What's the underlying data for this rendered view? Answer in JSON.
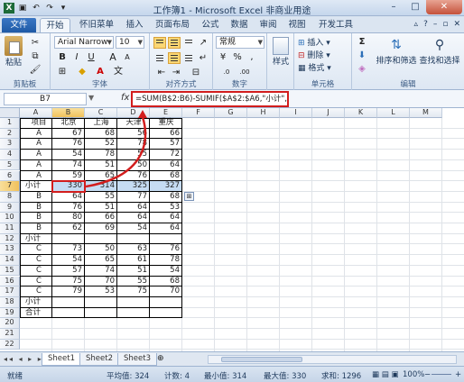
{
  "window": {
    "title": "工作簿1 - Microsoft Excel 非商业用途",
    "minimize": "–",
    "maximize": "□",
    "close": "✕"
  },
  "tabs": [
    "文件",
    "开始",
    "怀旧菜单",
    "插入",
    "页面布局",
    "公式",
    "数据",
    "审阅",
    "视图",
    "开发工具"
  ],
  "ribbon": {
    "clipboard": {
      "paste": "粘贴",
      "label": "剪贴板"
    },
    "font": {
      "name": "Arial Narrow",
      "size": "10",
      "bold": "B",
      "italic": "I",
      "underline": "U",
      "grow": "A",
      "shrink": "A",
      "label": "字体"
    },
    "alignment": {
      "label": "对齐方式"
    },
    "number": {
      "format": "常规",
      "label": "数字"
    },
    "styles": {
      "name": "样式",
      "label": ""
    },
    "cells": {
      "insert": "插入",
      "delete": "删除",
      "format": "格式",
      "label": "单元格"
    },
    "editing": {
      "sigma": "Σ",
      "sort_filter": "排序和筛选",
      "find_select": "查找和选择",
      "label": "编辑"
    }
  },
  "formula_bar": {
    "name_box": "B7",
    "fx": "fx",
    "formula": "=SUM(B$2:B6)-SUMIF($A$2:$A6,\"小计\",B$2:B6)*2"
  },
  "sheet": {
    "columns": [
      "A",
      "B",
      "C",
      "D",
      "E",
      "F",
      "G",
      "H",
      "I",
      "J",
      "K",
      "L",
      "M"
    ],
    "selected_column": "B",
    "selected_row": 7,
    "rows": [
      {
        "n": 1,
        "cells": [
          "项目",
          "北京",
          "上海",
          "天津",
          "重庆"
        ]
      },
      {
        "n": 2,
        "cells": [
          "A",
          "67",
          "68",
          "56",
          "66"
        ]
      },
      {
        "n": 3,
        "cells": [
          "A",
          "76",
          "52",
          "78",
          "57"
        ]
      },
      {
        "n": 4,
        "cells": [
          "A",
          "54",
          "78",
          "55",
          "72"
        ]
      },
      {
        "n": 5,
        "cells": [
          "A",
          "74",
          "51",
          "50",
          "64"
        ]
      },
      {
        "n": 6,
        "cells": [
          "A",
          "59",
          "65",
          "76",
          "68"
        ]
      },
      {
        "n": 7,
        "cells": [
          "小计",
          "330",
          "314",
          "325",
          "327"
        ]
      },
      {
        "n": 8,
        "cells": [
          "B",
          "64",
          "55",
          "77",
          "68"
        ]
      },
      {
        "n": 9,
        "cells": [
          "B",
          "76",
          "51",
          "64",
          "53"
        ]
      },
      {
        "n": 10,
        "cells": [
          "B",
          "80",
          "66",
          "64",
          "64"
        ]
      },
      {
        "n": 11,
        "cells": [
          "B",
          "62",
          "69",
          "54",
          "64"
        ]
      },
      {
        "n": 12,
        "cells": [
          "小计",
          "",
          "",
          "",
          ""
        ]
      },
      {
        "n": 13,
        "cells": [
          "C",
          "73",
          "50",
          "63",
          "76"
        ]
      },
      {
        "n": 14,
        "cells": [
          "C",
          "54",
          "65",
          "61",
          "78"
        ]
      },
      {
        "n": 15,
        "cells": [
          "C",
          "57",
          "74",
          "51",
          "54"
        ]
      },
      {
        "n": 16,
        "cells": [
          "C",
          "75",
          "70",
          "55",
          "68"
        ]
      },
      {
        "n": 17,
        "cells": [
          "C",
          "79",
          "53",
          "75",
          "70"
        ]
      },
      {
        "n": 18,
        "cells": [
          "小计",
          "",
          "",
          "",
          ""
        ]
      },
      {
        "n": 19,
        "cells": [
          "合计",
          "",
          "",
          "",
          ""
        ]
      },
      {
        "n": 20,
        "cells": [
          "",
          "",
          "",
          "",
          ""
        ]
      },
      {
        "n": 21,
        "cells": [
          "",
          "",
          "",
          "",
          ""
        ]
      },
      {
        "n": 22,
        "cells": [
          "",
          "",
          "",
          "",
          ""
        ]
      }
    ],
    "tabs": [
      "Sheet1",
      "Sheet2",
      "Sheet3"
    ],
    "active_tab": "Sheet1"
  },
  "status": {
    "mode": "就绪",
    "average": "平均值: 324",
    "count": "计数: 4",
    "min": "最小值: 314",
    "max": "最大值: 330",
    "sum": "求和: 1296",
    "zoom": "100%",
    "zoom_minus": "−",
    "zoom_plus": "+"
  },
  "colors": {
    "formula_highlight": "#d21d1d",
    "selection_fill": "#c6dcf3",
    "arrow": "#d21d1d"
  }
}
